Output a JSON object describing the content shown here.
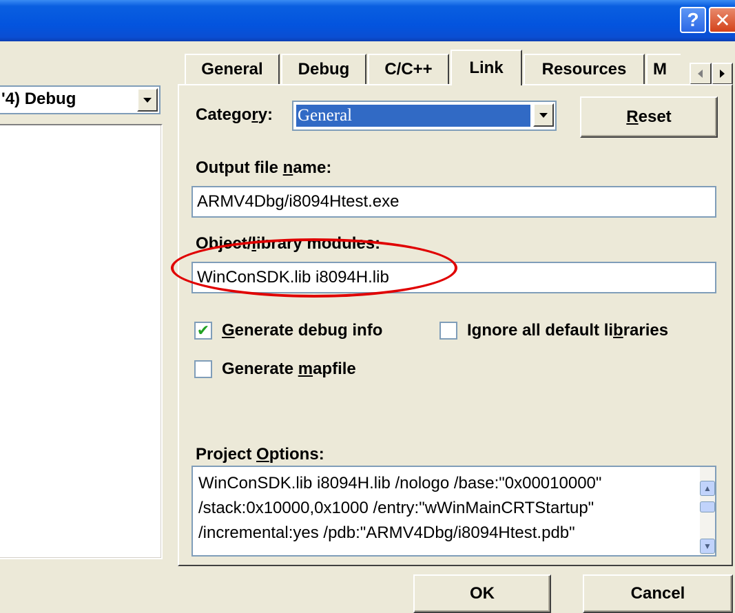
{
  "titlebar": {
    "help_label": "?",
    "close_label": "✕",
    "accent_color": "#0054e3"
  },
  "left_pane": {
    "settings_for_value": "'4) Debug"
  },
  "tabs": [
    {
      "label": "General"
    },
    {
      "label": "Debug"
    },
    {
      "label": "C/C++"
    },
    {
      "label": "Link",
      "active": true
    },
    {
      "label": "Resources"
    },
    {
      "label": "M"
    }
  ],
  "link": {
    "category_label_pre": "Catego",
    "category_label_ul": "r",
    "category_label_post": "y:",
    "category_value": "General",
    "reset_ul": "R",
    "reset_rest": "eset",
    "output_label_pre": "Output file ",
    "output_label_ul": "n",
    "output_label_post": "ame:",
    "output_value": "ARMV4Dbg/i8094Htest.exe",
    "modules_label_pre": "Object/",
    "modules_label_ul": "l",
    "modules_label_post": "ibrary modules:",
    "modules_value": "WinConSDK.lib i8094H.lib",
    "gen_debug_ul": "G",
    "gen_debug_rest": "enerate debug info",
    "gen_debug_checked": true,
    "ignore_pre": "Ignore all default li",
    "ignore_ul": "b",
    "ignore_post": "raries",
    "ignore_checked": false,
    "mapfile_pre": "Generate ",
    "mapfile_ul": "m",
    "mapfile_post": "apfile",
    "mapfile_checked": false,
    "project_options_pre": "Project ",
    "project_options_ul": "O",
    "project_options_post": "ptions:",
    "project_options_lines": [
      "WinConSDK.lib i8094H.lib /nologo /base:\"0x00010000\"",
      "/stack:0x10000,0x1000 /entry:\"wWinMainCRTStartup\"",
      "/incremental:yes /pdb:\"ARMV4Dbg/i8094Htest.pdb\""
    ]
  },
  "footer": {
    "ok_label": "OK",
    "cancel_label": "Cancel"
  },
  "annotation_color": "#e00000"
}
